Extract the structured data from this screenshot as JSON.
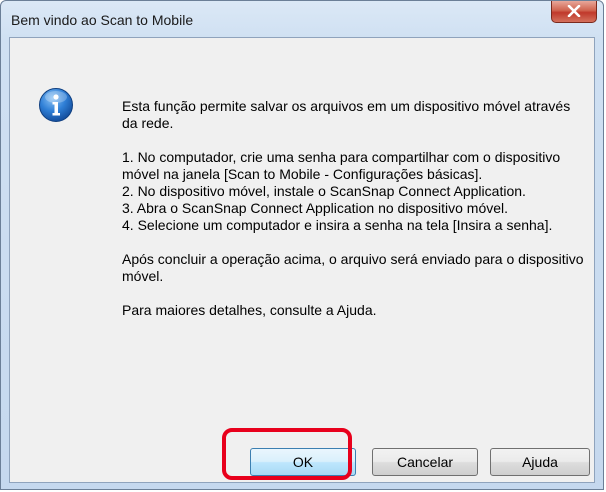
{
  "window": {
    "title": "Bem vindo ao Scan to Mobile",
    "close_icon": "close-icon"
  },
  "dialog": {
    "icon": "info-icon",
    "intro": "Esta função permite salvar os arquivos em um dispositivo móvel através da rede.",
    "steps": [
      "1. No computador, crie uma senha para compartilhar com o dispositivo móvel na janela [Scan to Mobile - Configurações básicas].",
      "2. No dispositivo móvel, instale o ScanSnap Connect Application.",
      "3. Abra o ScanSnap Connect Application no dispositivo móvel.",
      "4. Selecione um computador e insira a senha na tela [Insira a senha]."
    ],
    "after": "Após concluir a operação acima, o arquivo será enviado para o dispositivo móvel.",
    "help_note": "Para maiores detalhes, consulte a Ajuda."
  },
  "buttons": {
    "ok_label": "OK",
    "cancel_label": "Cancelar",
    "help_label": "Ajuda"
  },
  "colors": {
    "highlight": "#e8001c",
    "close_button": "#c0392b"
  }
}
